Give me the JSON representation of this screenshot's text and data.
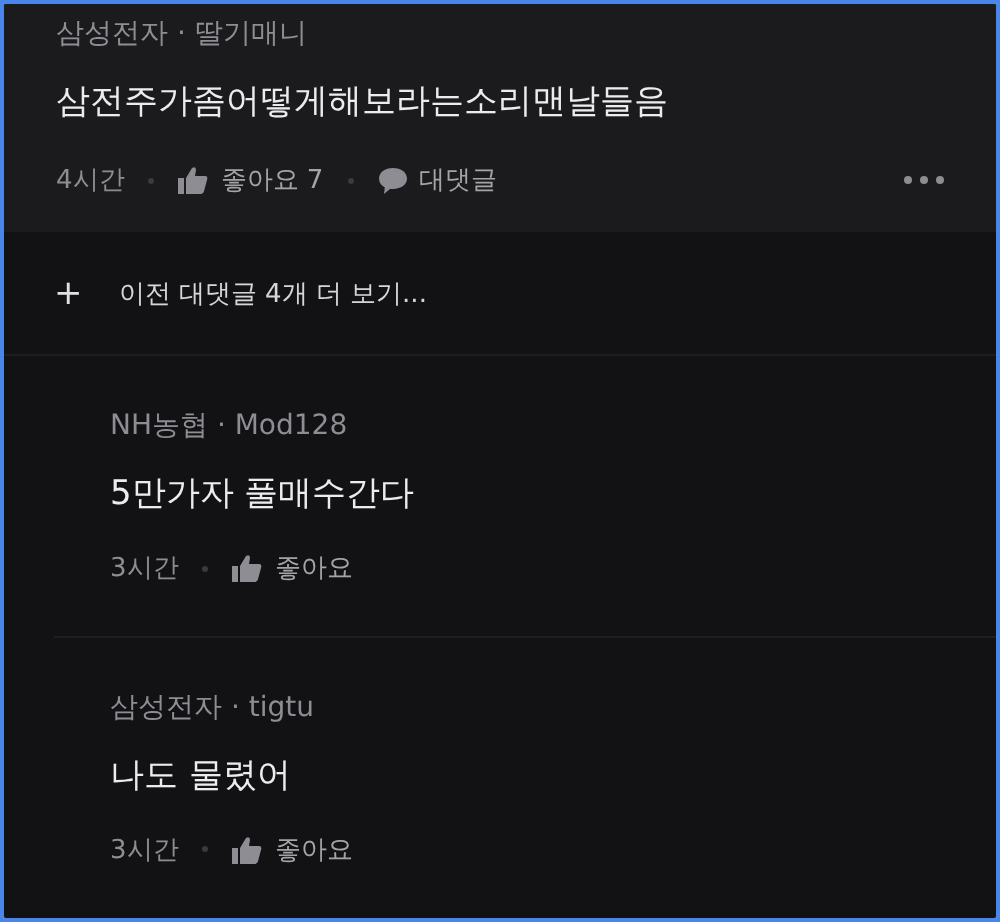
{
  "main_comment": {
    "author": "삼성전자 · 딸기매니",
    "text": "삼전주가좀어떻게해보라는소리맨날들음",
    "time": "4시간",
    "like_label": "좋아요 7",
    "reply_label": "대댓글"
  },
  "load_more": {
    "icon": "+",
    "label": "이전 대댓글 4개 더 보기..."
  },
  "replies": [
    {
      "author": "NH농협 · Mod128",
      "text": "5만가자 풀매수간다",
      "time": "3시간",
      "like_label": "좋아요"
    },
    {
      "author": "삼성전자 · tigtu",
      "text": "나도 물렸어",
      "time": "3시간",
      "like_label": "좋아요"
    }
  ]
}
